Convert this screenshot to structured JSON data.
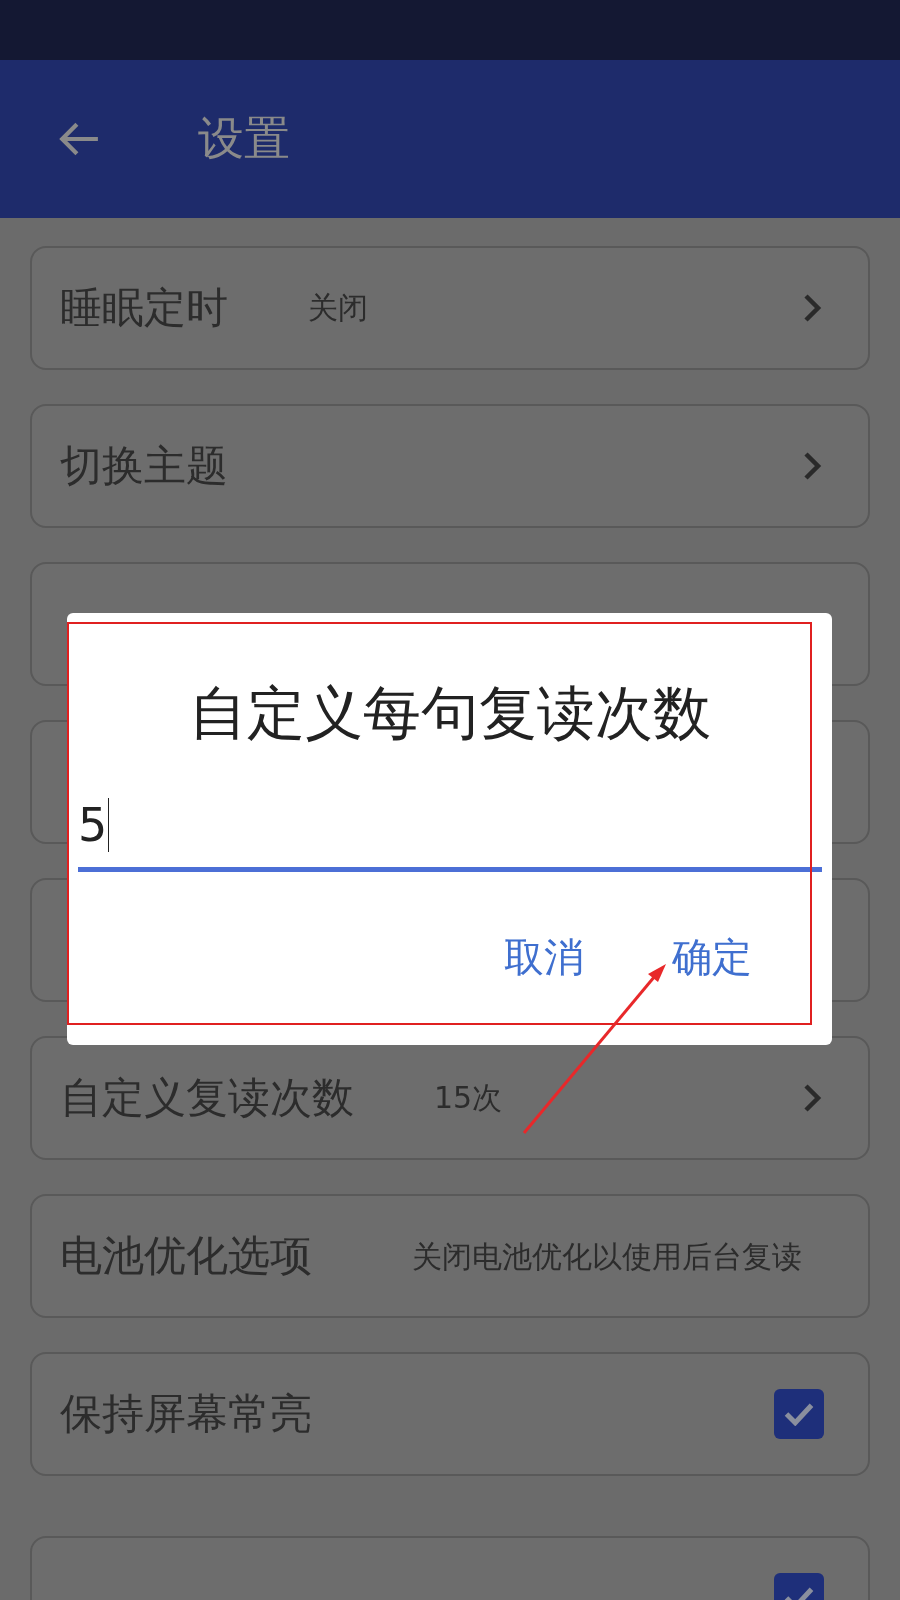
{
  "app_bar": {
    "title": "设置"
  },
  "settings": [
    {
      "kind": "link",
      "label": "睡眠定时",
      "value": "关闭"
    },
    {
      "kind": "link",
      "label": "切换主题"
    },
    {
      "kind": "covered"
    },
    {
      "kind": "covered"
    },
    {
      "kind": "covered"
    },
    {
      "kind": "link",
      "label": "自定义复读次数",
      "value": "15次"
    },
    {
      "kind": "note",
      "label": "电池优化选项",
      "value": "关闭电池优化以使用后台复读"
    },
    {
      "kind": "checkbox",
      "label": "保持屏幕常亮",
      "checked": true
    },
    {
      "kind": "checkbox",
      "checked": true
    }
  ],
  "dialog": {
    "title": "自定义每句复读次数",
    "value": "5",
    "buttons": [
      "取消",
      "确定"
    ]
  },
  "annotations": [
    {
      "kind": "box"
    },
    {
      "kind": "arrow"
    }
  ]
}
